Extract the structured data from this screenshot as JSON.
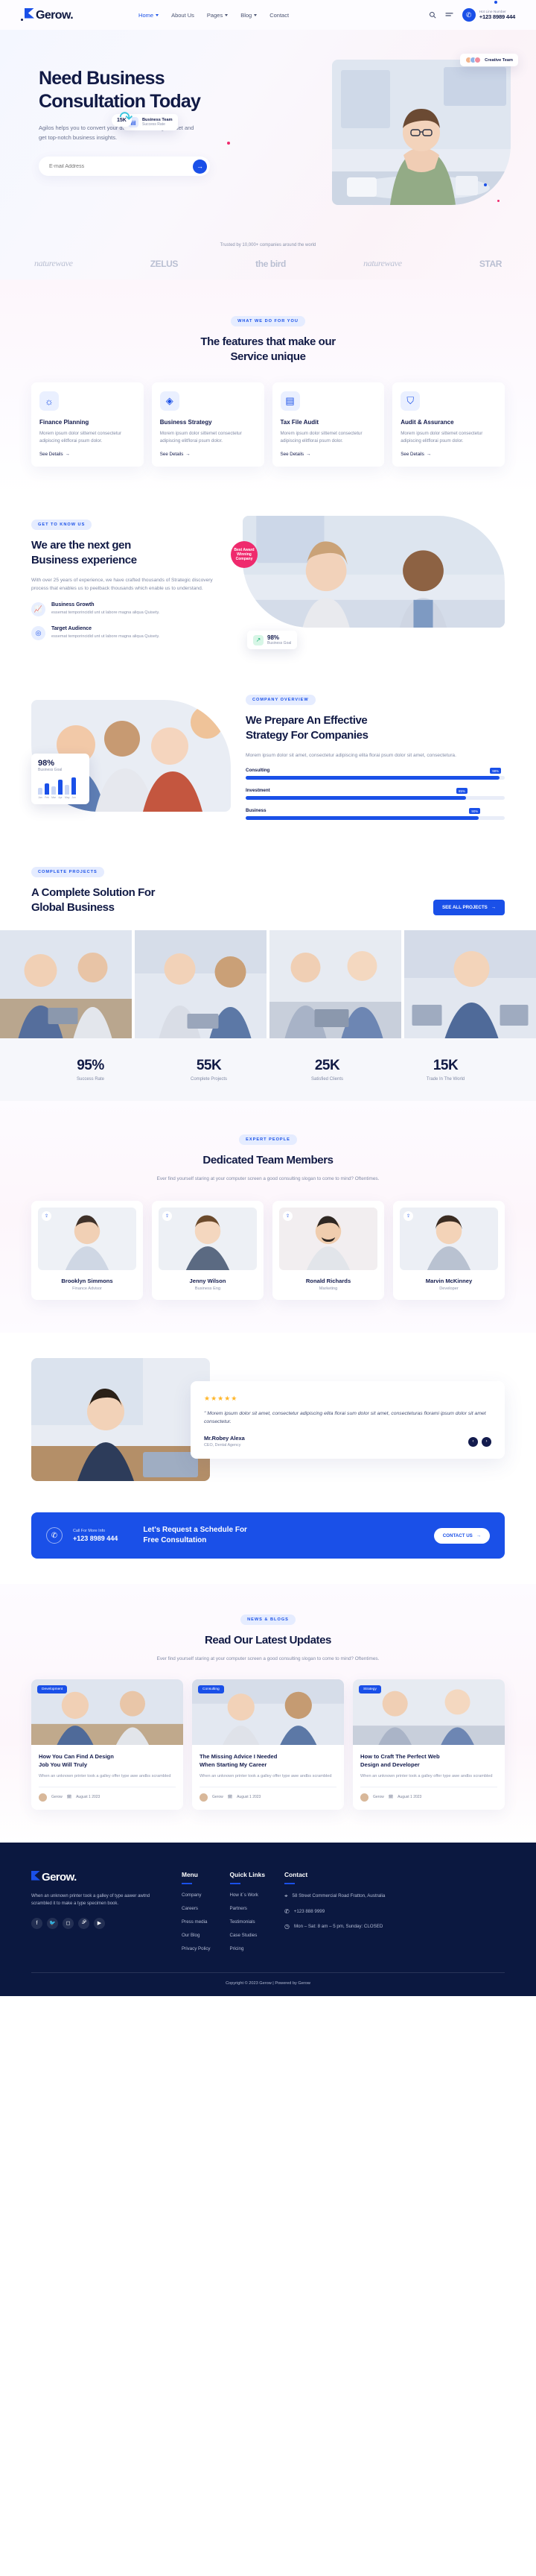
{
  "brand": {
    "name": "Gerow.",
    "logo_icon": "gerow-logo-mark"
  },
  "header": {
    "nav": [
      {
        "label": "Home",
        "has_caret": true,
        "active": true
      },
      {
        "label": "About Us",
        "has_caret": false,
        "active": false
      },
      {
        "label": "Pages",
        "has_caret": true,
        "active": false
      },
      {
        "label": "Blog",
        "has_caret": true,
        "active": false
      },
      {
        "label": "Contact",
        "has_caret": false,
        "active": false
      }
    ],
    "search_icon": "search-icon",
    "menu_icon": "hamburger-icon",
    "hotline_label": "Hot Line Number",
    "hotline_number": "+123 8989 444",
    "phone_icon": "phone-icon"
  },
  "hero": {
    "title": "Need Business Consultation Today",
    "paragraph": "Agilos helps you to convert your data into a strategic asset and get top-notch business insights.",
    "email_placeholder": "E-mail Address",
    "email_value": "",
    "submit_icon": "arrow-right-icon",
    "badge_creative": "Creative Team",
    "badge_business_title": "Business Team",
    "badge_business_sub": "Success Rate",
    "pill_15k": "15K",
    "trusted": "Trusted by 10,000+ companies around the world",
    "logos": [
      {
        "name": "naturewave",
        "style": "script"
      },
      {
        "name": "ZELUS",
        "style": "bold"
      },
      {
        "name": "the bird",
        "style": "bold"
      },
      {
        "name": "naturewave",
        "style": "script"
      },
      {
        "name": "STAR",
        "style": "bold"
      }
    ]
  },
  "features": {
    "eyebrow": "WHAT WE DO FOR YOU",
    "title_line1": "The features that make our",
    "title_line2": "Service unique",
    "cards": [
      {
        "icon": "lightbulb-gear-icon",
        "title": "Finance Planning",
        "text": "Morem ipsum dolor sittemet consectetur adipiscing elitflorai psum dolor.",
        "link": "See Details"
      },
      {
        "icon": "layers-icon",
        "title": "Business Strategy",
        "text": "Morem ipsum dolor sittemet consectetur adipiscing elitflorai psum dolor.",
        "link": "See Details"
      },
      {
        "icon": "file-search-icon",
        "title": "Tax File Audit",
        "text": "Morem ipsum dolor sittemet consectetur adipiscing elitflorai psum dolor.",
        "link": "See Details"
      },
      {
        "icon": "shield-check-icon",
        "title": "Audit & Assurance",
        "text": "Morem ipsum dolor sittemet consectetur adipiscing elitflorai psum dolor.",
        "link": "See Details"
      }
    ]
  },
  "about": {
    "eyebrow": "GET TO KNOW US",
    "title_line1": "We are the next gen",
    "title_line2": "Business experience",
    "paragraph": "With over 25 years of experience, we have crafted thousands of Strategic discovery process that enables us to peelback thousands which enable us to understand.",
    "points": [
      {
        "icon": "growth-chart-icon",
        "title": "Business Growth",
        "text": "essemat temporincidid unt ut labore magna aliqua Quisety."
      },
      {
        "icon": "target-icon",
        "title": "Target Audience",
        "text": "essemat temporincidid unt ut labore magna aliqua Quisety."
      }
    ],
    "stat_circle": "Best Award Winning Company",
    "goal_value": "98%",
    "goal_label": "Business Goal"
  },
  "strategy": {
    "eyebrow": "COMPANY OVERVIEW",
    "title_line1": "We Prepare An Effective",
    "title_line2": "Strategy For Companies",
    "paragraph": "Morem ipsum dolor sit amet, consectetur adipiscing elita florai psum dolor sit amet, consectetura.",
    "pct_value": "98%",
    "pct_label": "Business Goal",
    "skills": [
      {
        "label": "Consulting",
        "value": "98%",
        "pct": 98
      },
      {
        "label": "Investment",
        "value": "85%",
        "pct": 85
      },
      {
        "label": "Business",
        "value": "90%",
        "pct": 90
      }
    ]
  },
  "projects": {
    "eyebrow": "COMPLETE PROJECTS",
    "title_line1": "A Complete Solution For",
    "title_line2": "Global Business",
    "button": "SEE ALL PROJECTS",
    "button_icon": "arrow-right-icon"
  },
  "stats": [
    {
      "value": "95%",
      "label": "Success Rate"
    },
    {
      "value": "55K",
      "label": "Complete Projects"
    },
    {
      "value": "25K",
      "label": "Satisfied Clients"
    },
    {
      "value": "15K",
      "label": "Trade In The World"
    }
  ],
  "team": {
    "eyebrow": "EXPERT PEOPLE",
    "title": "Dedicated Team Members",
    "paragraph": "Ever find yourself staring at your computer screen a good consulting slogan to come to mind? Oftentimes.",
    "share_icon": "share-icon",
    "members": [
      {
        "name": "Brooklyn Simmons",
        "role": "Finance Advisor"
      },
      {
        "name": "Jenny Wilson",
        "role": "Business Eng"
      },
      {
        "name": "Ronald Richards",
        "role": "Marketing"
      },
      {
        "name": "Marvin McKinney",
        "role": "Developer"
      }
    ]
  },
  "testimonial": {
    "stars": 5,
    "quote": "\" Morem ipsum dolor sit amet, consectetur adipiscing elita florai sum dolor sit amet, consecteturas florami ipsum dolor sit amet consectetur.",
    "name": "Mr.Robey Alexa",
    "role": "CEO, Dental Agency",
    "prev_icon": "chevron-left-icon",
    "next_icon": "chevron-right-icon"
  },
  "cta": {
    "small": "Call For More Info",
    "phone": "+123 8989 444",
    "phone_icon": "phone-icon",
    "headline_line1": "Let's Request a Schedule For",
    "headline_line2": "Free Consultation",
    "button": "CONTACT US",
    "button_icon": "arrow-right-icon"
  },
  "blog": {
    "eyebrow": "NEWS & BLOGS",
    "title": "Read Our Latest Updates",
    "paragraph": "Ever find yourself staring at your computer screen a good consulting slogan to come to mind? Oftentimes.",
    "posts": [
      {
        "tag": "Development",
        "title_line1": "How You Can Find A Design",
        "title_line2": "Job You Will Truly",
        "text": "When an unknown printer took a galley offer type awe andbs scrambled",
        "author": "Gerow",
        "date": "August 1 2023",
        "author_icon": "user-avatar",
        "date_icon": "calendar-icon"
      },
      {
        "tag": "Consulting",
        "title_line1": "The Missing Advice I Needed",
        "title_line2": "When Starting My Career",
        "text": "When an unknown printer took a galley offer type awe andbs scrambled",
        "author": "Gerow",
        "date": "August 1 2023",
        "author_icon": "user-avatar",
        "date_icon": "calendar-icon"
      },
      {
        "tag": "Strategy",
        "title_line1": "How to Craft The Perfect Web",
        "title_line2": "Design and Developer",
        "text": "When an unknown printer took a galley offer type awe andbs scrambled",
        "author": "Gerow",
        "date": "August 1 2023",
        "author_icon": "user-avatar",
        "date_icon": "calendar-icon"
      }
    ]
  },
  "footer": {
    "about": "When an unknown printer took a galley of type aawer awtnd scrambled it to make a type specimen book.",
    "socials": [
      "facebook-icon",
      "twitter-icon",
      "instagram-icon",
      "pinterest-icon",
      "youtube-icon"
    ],
    "menu_title": "Menu",
    "menu_links": [
      "Company",
      "Careers",
      "Press media",
      "Our Blog",
      "Privacy Policy"
    ],
    "quick_title": "Quick Links",
    "quick_links": [
      "How it´s Work",
      "Partners",
      "Testimonials",
      "Case Studies",
      "Pricing"
    ],
    "contact_title": "Contact",
    "address": "58 Street Commercial Road Fratton, Australia",
    "phone": "+123 888 9999",
    "hours": "Mon – Sat: 8 am – 5 pm, Sunday: CLOSED",
    "address_icon": "location-pin-icon",
    "phone_icon": "phone-icon",
    "clock_icon": "clock-icon",
    "copyright": "Copyright © 2023 Gerow | Powered by Gerow"
  },
  "colors": {
    "accent": "#1a50e8",
    "dark": "#0b1840",
    "pink": "#ef2a6d",
    "star": "#ffb629"
  }
}
